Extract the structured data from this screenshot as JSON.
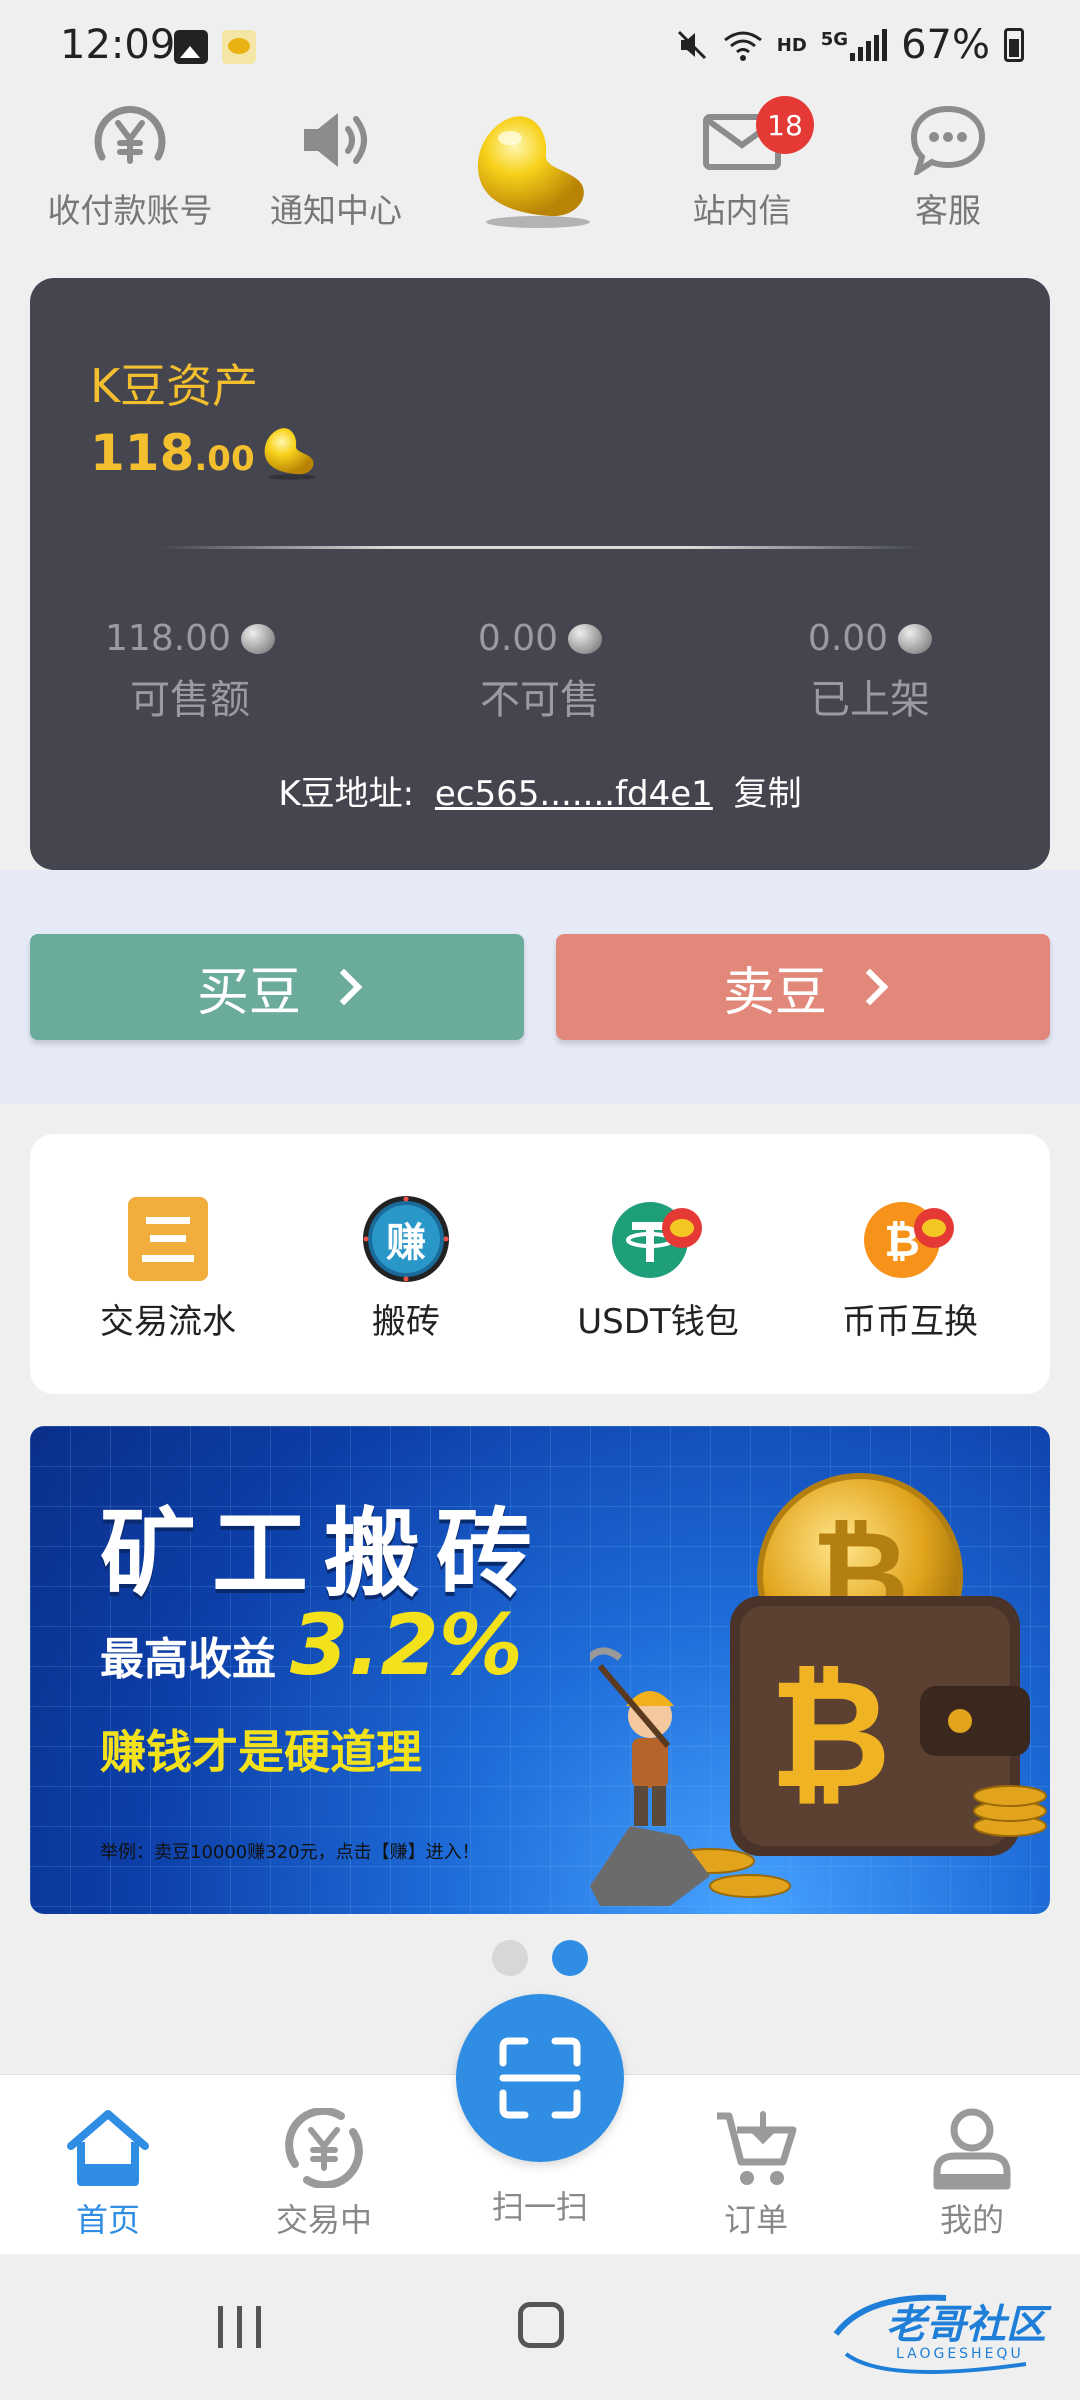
{
  "status_bar": {
    "time": "12:09",
    "hd": "HD",
    "net": "5G",
    "battery": "67%"
  },
  "top_nav": {
    "items": [
      {
        "label": "收付款账号",
        "icon": "yuan-refresh-icon"
      },
      {
        "label": "通知中心",
        "icon": "speaker-icon"
      },
      {
        "label": "站内信",
        "icon": "mail-icon",
        "badge": "18"
      },
      {
        "label": "客服",
        "icon": "chat-bubble-icon"
      }
    ],
    "logo_icon": "golden-bean-icon"
  },
  "asset": {
    "title": "K豆资产",
    "amount_int": "118",
    "amount_dec": ".00",
    "stats": [
      {
        "value": "118.00",
        "label": "可售额"
      },
      {
        "value": "0.00",
        "label": "不可售"
      },
      {
        "value": "0.00",
        "label": "已上架"
      }
    ],
    "address_label": "K豆地址:",
    "address": "ec565.......fd4e1",
    "copy_label": "复制"
  },
  "trade": {
    "buy_label": "买豆",
    "sell_label": "卖豆",
    "buy_color": "#6aab9c",
    "sell_color": "#e2887a"
  },
  "quick_actions": [
    {
      "label": "交易流水",
      "icon": "ledger-icon"
    },
    {
      "label": "搬砖",
      "icon": "earn-badge-icon",
      "glyph": "赚"
    },
    {
      "label": "USDT钱包",
      "icon": "usdt-wallet-icon"
    },
    {
      "label": "币币互换",
      "icon": "bitcoin-swap-icon"
    }
  ],
  "banner": {
    "title": "矿工搬砖",
    "subtitle_prefix": "最高收益",
    "subtitle_rate": "3.2%",
    "slogan": "赚钱才是硬道理",
    "note": "举例：卖豆10000赚320元，点击【赚】进入！",
    "page_count": 2,
    "active_page": 2
  },
  "bottom_nav": {
    "items": [
      {
        "label": "首页",
        "icon": "home-icon",
        "active": true
      },
      {
        "label": "交易中",
        "icon": "yuan-exchange-icon",
        "active": false
      },
      {
        "label": "扫一扫",
        "icon": "scan-icon",
        "active": false
      },
      {
        "label": "订单",
        "icon": "cart-icon",
        "active": false
      },
      {
        "label": "我的",
        "icon": "user-icon",
        "active": false
      }
    ],
    "accent": "#2f8de4"
  },
  "watermark": {
    "text": "老哥社区",
    "sub": "LAOGESHEQU"
  }
}
